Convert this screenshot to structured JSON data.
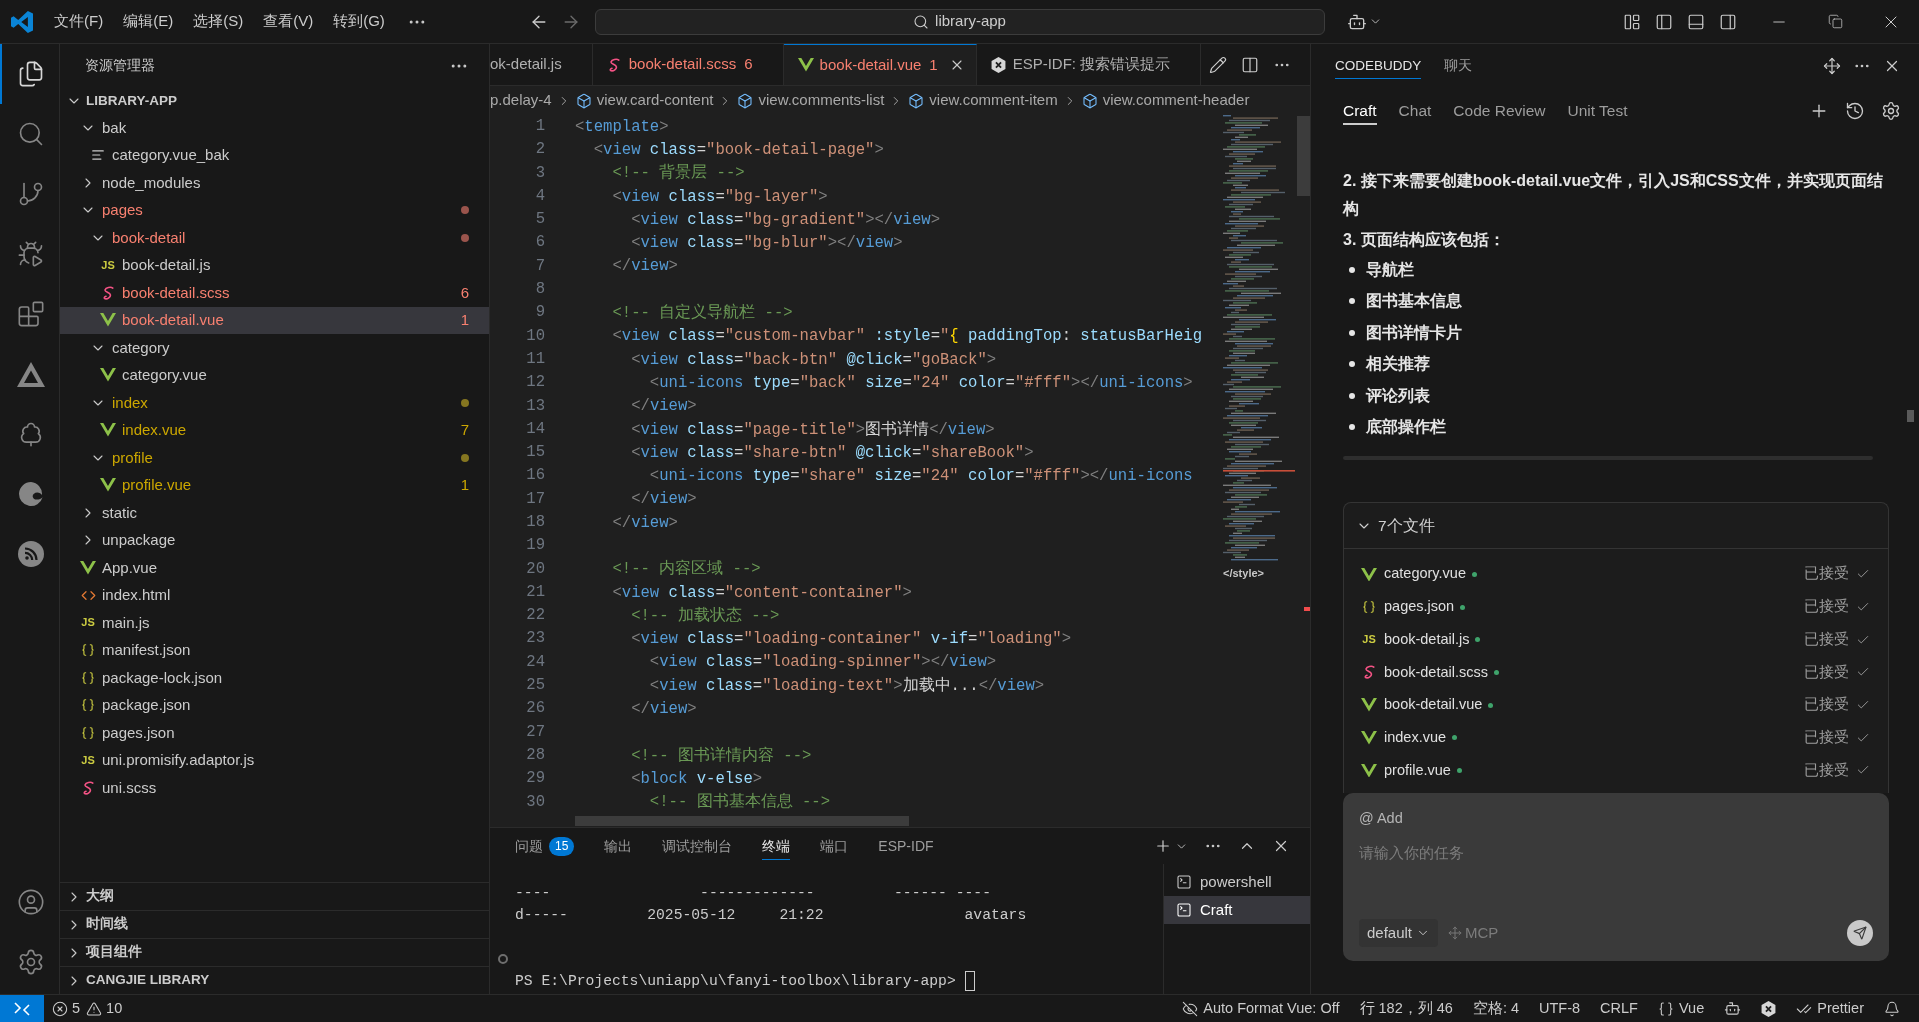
{
  "title_bar": {
    "menus": [
      "文件(F)",
      "编辑(E)",
      "选择(S)",
      "查看(V)",
      "转到(G)"
    ],
    "search": {
      "label": "library-app"
    }
  },
  "activity_bar": {
    "items": [
      {
        "kind": "explorer",
        "selected": true
      },
      {
        "kind": "search",
        "selected": false
      },
      {
        "kind": "source-control",
        "selected": false
      },
      {
        "kind": "run-debug",
        "selected": false
      },
      {
        "kind": "extensions",
        "selected": false
      },
      {
        "kind": "triangle",
        "selected": false
      },
      {
        "kind": "tree",
        "selected": false
      },
      {
        "kind": "swirl",
        "selected": false
      },
      {
        "kind": "signal",
        "selected": false
      }
    ],
    "bottom": [
      {
        "kind": "account"
      },
      {
        "kind": "settings"
      }
    ]
  },
  "explorer": {
    "title": "资源管理器",
    "root": {
      "label": "LIBRARY-APP",
      "expanded": true
    },
    "tree": [
      {
        "label": "bak",
        "kind": "folder",
        "expanded": true,
        "selected": false,
        "error": false,
        "warning": false,
        "children": [
          {
            "label": "category.vue_bak",
            "kind": "text",
            "selected": false,
            "error": false,
            "warning": false
          }
        ]
      },
      {
        "label": "node_modules",
        "kind": "folder",
        "expanded": false,
        "selected": false,
        "error": false,
        "warning": false
      },
      {
        "label": "pages",
        "kind": "folder",
        "expanded": true,
        "selected": false,
        "error": true,
        "warning": false,
        "children": [
          {
            "label": "book-detail",
            "kind": "folder",
            "expanded": true,
            "selected": false,
            "error": true,
            "warning": false,
            "children": [
              {
                "label": "book-detail.js",
                "kind": "js",
                "icon_text": "JS",
                "selected": false,
                "error": false,
                "warning": false
              },
              {
                "label": "book-detail.scss",
                "kind": "scss",
                "selected": false,
                "error": true,
                "warning": false,
                "badge": "6"
              },
              {
                "label": "book-detail.vue",
                "kind": "vue",
                "selected": true,
                "error": true,
                "warning": false,
                "badge": "1"
              }
            ]
          },
          {
            "label": "category",
            "kind": "folder",
            "expanded": true,
            "selected": false,
            "error": false,
            "warning": false,
            "children": [
              {
                "label": "category.vue",
                "kind": "vue",
                "selected": false,
                "error": false,
                "warning": false
              }
            ]
          },
          {
            "label": "index",
            "kind": "folder",
            "expanded": true,
            "selected": false,
            "error": false,
            "warning": true,
            "children": [
              {
                "label": "index.vue",
                "kind": "vue",
                "selected": false,
                "error": false,
                "warning": true,
                "badge": "7"
              }
            ]
          },
          {
            "label": "profile",
            "kind": "folder",
            "expanded": true,
            "selected": false,
            "error": false,
            "warning": true,
            "children": [
              {
                "label": "profile.vue",
                "kind": "vue",
                "selected": false,
                "error": false,
                "warning": true,
                "badge": "1"
              }
            ]
          }
        ]
      },
      {
        "label": "static",
        "kind": "folder",
        "expanded": false,
        "selected": false,
        "error": false,
        "warning": false
      },
      {
        "label": "unpackage",
        "kind": "folder",
        "expanded": false,
        "selected": false,
        "error": false,
        "warning": false
      },
      {
        "label": "App.vue",
        "kind": "vue",
        "selected": false,
        "error": false,
        "warning": false
      },
      {
        "label": "index.html",
        "kind": "html",
        "selected": false,
        "error": false,
        "warning": false
      },
      {
        "label": "main.js",
        "kind": "js",
        "icon_text": "JS",
        "selected": false,
        "error": false,
        "warning": false
      },
      {
        "label": "manifest.json",
        "kind": "json",
        "selected": false,
        "error": false,
        "warning": false
      },
      {
        "label": "package-lock.json",
        "kind": "json",
        "selected": false,
        "error": false,
        "warning": false
      },
      {
        "label": "package.json",
        "kind": "json",
        "selected": false,
        "error": false,
        "warning": false
      },
      {
        "label": "pages.json",
        "kind": "json",
        "selected": false,
        "error": false,
        "warning": false
      },
      {
        "label": "uni.promisify.adaptor.js",
        "kind": "js",
        "icon_text": "JS",
        "selected": false,
        "error": false,
        "warning": false
      },
      {
        "label": "uni.scss",
        "kind": "scss",
        "selected": false,
        "error": false,
        "warning": false
      }
    ],
    "sections": [
      {
        "label": "大纲",
        "expanded": false
      },
      {
        "label": "时间线",
        "expanded": false
      },
      {
        "label": "项目组件",
        "expanded": false
      },
      {
        "label": "CANGJIE LIBRARY",
        "expanded": false
      }
    ]
  },
  "editor": {
    "tabs": [
      {
        "label": "ok-detail.js",
        "error": false,
        "selected": false
      },
      {
        "label": "book-detail.scss",
        "kind": "scss",
        "error": true,
        "badge": "6",
        "selected": false
      },
      {
        "label": "book-detail.vue",
        "kind": "vue",
        "error": true,
        "badge": "1",
        "selected": true
      },
      {
        "label": "ESP-IDF: 搜索错误提示",
        "kind": "esp",
        "error": false,
        "selected": false
      }
    ],
    "breadcrumbs": [
      {
        "label": "p.delay-4"
      },
      {
        "label": "view.card-content",
        "kind": "element"
      },
      {
        "label": "view.comments-list",
        "kind": "element"
      },
      {
        "label": "view.comment-item",
        "kind": "element"
      },
      {
        "label": "view.comment-header",
        "kind": "element"
      }
    ],
    "lines": [
      {
        "number": "1",
        "tokens": [
          {
            "kind": "punct",
            "text": "<"
          },
          {
            "kind": "tag",
            "text": "template"
          },
          {
            "kind": "punct",
            "text": ">"
          }
        ]
      },
      {
        "number": "2",
        "tokens": [
          {
            "kind": "punct",
            "text": "  <"
          },
          {
            "kind": "tag",
            "text": "view"
          },
          {
            "kind": "attr",
            "text": " class"
          },
          {
            "kind": "text",
            "text": "="
          },
          {
            "kind": "string",
            "text": "\"book-detail-page\""
          },
          {
            "kind": "punct",
            "text": ">"
          }
        ]
      },
      {
        "number": "3",
        "tokens": [
          {
            "kind": "comment",
            "text": "    <!-- 背景层 -->"
          }
        ]
      },
      {
        "number": "4",
        "tokens": [
          {
            "kind": "punct",
            "text": "    <"
          },
          {
            "kind": "tag",
            "text": "view"
          },
          {
            "kind": "attr",
            "text": " class"
          },
          {
            "kind": "text",
            "text": "="
          },
          {
            "kind": "string",
            "text": "\"bg-layer\""
          },
          {
            "kind": "punct",
            "text": ">"
          }
        ]
      },
      {
        "number": "5",
        "tokens": [
          {
            "kind": "punct",
            "text": "      <"
          },
          {
            "kind": "tag",
            "text": "view"
          },
          {
            "kind": "attr",
            "text": " class"
          },
          {
            "kind": "text",
            "text": "="
          },
          {
            "kind": "string",
            "text": "\"bg-gradient\""
          },
          {
            "kind": "punct",
            "text": "></"
          },
          {
            "kind": "tag",
            "text": "view"
          },
          {
            "kind": "punct",
            "text": ">"
          }
        ]
      },
      {
        "number": "6",
        "tokens": [
          {
            "kind": "punct",
            "text": "      <"
          },
          {
            "kind": "tag",
            "text": "view"
          },
          {
            "kind": "attr",
            "text": " class"
          },
          {
            "kind": "text",
            "text": "="
          },
          {
            "kind": "string",
            "text": "\"bg-blur\""
          },
          {
            "kind": "punct",
            "text": "></"
          },
          {
            "kind": "tag",
            "text": "view"
          },
          {
            "kind": "punct",
            "text": ">"
          }
        ]
      },
      {
        "number": "7",
        "tokens": [
          {
            "kind": "punct",
            "text": "    </"
          },
          {
            "kind": "tag",
            "text": "view"
          },
          {
            "kind": "punct",
            "text": ">"
          }
        ]
      },
      {
        "number": "8"
      },
      {
        "number": "9",
        "tokens": [
          {
            "kind": "comment",
            "text": "    <!-- 自定义导航栏 -->"
          }
        ]
      },
      {
        "number": "10",
        "tokens": [
          {
            "kind": "punct",
            "text": "    <"
          },
          {
            "kind": "tag",
            "text": "view"
          },
          {
            "kind": "attr",
            "text": " class"
          },
          {
            "kind": "text",
            "text": "="
          },
          {
            "kind": "string",
            "text": "\"custom-navbar\""
          },
          {
            "kind": "attr",
            "text": " :style"
          },
          {
            "kind": "text",
            "text": "="
          },
          {
            "kind": "string",
            "text": "\""
          },
          {
            "kind": "brace",
            "text": "{"
          },
          {
            "kind": "attr",
            "text": " paddingTop"
          },
          {
            "kind": "text",
            "text": ":"
          },
          {
            "kind": "attr",
            "text": " statusBarHeig"
          }
        ]
      },
      {
        "number": "11",
        "tokens": [
          {
            "kind": "punct",
            "text": "      <"
          },
          {
            "kind": "tag",
            "text": "view"
          },
          {
            "kind": "attr",
            "text": " class"
          },
          {
            "kind": "text",
            "text": "="
          },
          {
            "kind": "string",
            "text": "\"back-btn\""
          },
          {
            "kind": "attr",
            "text": " @click"
          },
          {
            "kind": "text",
            "text": "="
          },
          {
            "kind": "string",
            "text": "\"goBack\""
          },
          {
            "kind": "punct",
            "text": ">"
          }
        ]
      },
      {
        "number": "12",
        "tokens": [
          {
            "kind": "punct",
            "text": "        <"
          },
          {
            "kind": "tag",
            "text": "uni-icons"
          },
          {
            "kind": "attr",
            "text": " type"
          },
          {
            "kind": "text",
            "text": "="
          },
          {
            "kind": "string",
            "text": "\"back\""
          },
          {
            "kind": "attr",
            "text": " size"
          },
          {
            "kind": "text",
            "text": "="
          },
          {
            "kind": "string",
            "text": "\"24\""
          },
          {
            "kind": "attr",
            "text": " color"
          },
          {
            "kind": "text",
            "text": "="
          },
          {
            "kind": "string",
            "text": "\"#fff\""
          },
          {
            "kind": "punct",
            "text": "></"
          },
          {
            "kind": "tag",
            "text": "uni-icons"
          },
          {
            "kind": "punct",
            "text": ">"
          }
        ]
      },
      {
        "number": "13",
        "tokens": [
          {
            "kind": "punct",
            "text": "      </"
          },
          {
            "kind": "tag",
            "text": "view"
          },
          {
            "kind": "punct",
            "text": ">"
          }
        ]
      },
      {
        "number": "14",
        "tokens": [
          {
            "kind": "punct",
            "text": "      <"
          },
          {
            "kind": "tag",
            "text": "view"
          },
          {
            "kind": "attr",
            "text": " class"
          },
          {
            "kind": "text",
            "text": "="
          },
          {
            "kind": "string",
            "text": "\"page-title\""
          },
          {
            "kind": "punct",
            "text": ">"
          },
          {
            "kind": "text",
            "text": "图书详情"
          },
          {
            "kind": "punct",
            "text": "</"
          },
          {
            "kind": "tag",
            "text": "view"
          },
          {
            "kind": "punct",
            "text": ">"
          }
        ]
      },
      {
        "number": "15",
        "tokens": [
          {
            "kind": "punct",
            "text": "      <"
          },
          {
            "kind": "tag",
            "text": "view"
          },
          {
            "kind": "attr",
            "text": " class"
          },
          {
            "kind": "text",
            "text": "="
          },
          {
            "kind": "string",
            "text": "\"share-btn\""
          },
          {
            "kind": "attr",
            "text": " @click"
          },
          {
            "kind": "text",
            "text": "="
          },
          {
            "kind": "string",
            "text": "\"shareBook\""
          },
          {
            "kind": "punct",
            "text": ">"
          }
        ]
      },
      {
        "number": "16",
        "tokens": [
          {
            "kind": "punct",
            "text": "        <"
          },
          {
            "kind": "tag",
            "text": "uni-icons"
          },
          {
            "kind": "attr",
            "text": " type"
          },
          {
            "kind": "text",
            "text": "="
          },
          {
            "kind": "string",
            "text": "\"share\""
          },
          {
            "kind": "attr",
            "text": " size"
          },
          {
            "kind": "text",
            "text": "="
          },
          {
            "kind": "string",
            "text": "\"24\""
          },
          {
            "kind": "attr",
            "text": " color"
          },
          {
            "kind": "text",
            "text": "="
          },
          {
            "kind": "string",
            "text": "\"#fff\""
          },
          {
            "kind": "punct",
            "text": "></"
          },
          {
            "kind": "tag",
            "text": "uni-icons"
          }
        ]
      },
      {
        "number": "17",
        "tokens": [
          {
            "kind": "punct",
            "text": "      </"
          },
          {
            "kind": "tag",
            "text": "view"
          },
          {
            "kind": "punct",
            "text": ">"
          }
        ]
      },
      {
        "number": "18",
        "tokens": [
          {
            "kind": "punct",
            "text": "    </"
          },
          {
            "kind": "tag",
            "text": "view"
          },
          {
            "kind": "punct",
            "text": ">"
          }
        ]
      },
      {
        "number": "19"
      },
      {
        "number": "20",
        "tokens": [
          {
            "kind": "comment",
            "text": "    <!-- 内容区域 -->"
          }
        ]
      },
      {
        "number": "21",
        "tokens": [
          {
            "kind": "punct",
            "text": "    <"
          },
          {
            "kind": "tag",
            "text": "view"
          },
          {
            "kind": "attr",
            "text": " class"
          },
          {
            "kind": "text",
            "text": "="
          },
          {
            "kind": "string",
            "text": "\"content-container\""
          },
          {
            "kind": "punct",
            "text": ">"
          }
        ]
      },
      {
        "number": "22",
        "tokens": [
          {
            "kind": "comment",
            "text": "      <!-- 加载状态 -->"
          }
        ]
      },
      {
        "number": "23",
        "tokens": [
          {
            "kind": "punct",
            "text": "      <"
          },
          {
            "kind": "tag",
            "text": "view"
          },
          {
            "kind": "attr",
            "text": " class"
          },
          {
            "kind": "text",
            "text": "="
          },
          {
            "kind": "string",
            "text": "\"loading-container\""
          },
          {
            "kind": "attr",
            "text": " v-if"
          },
          {
            "kind": "text",
            "text": "="
          },
          {
            "kind": "string",
            "text": "\"loading\""
          },
          {
            "kind": "punct",
            "text": ">"
          }
        ]
      },
      {
        "number": "24",
        "tokens": [
          {
            "kind": "punct",
            "text": "        <"
          },
          {
            "kind": "tag",
            "text": "view"
          },
          {
            "kind": "attr",
            "text": " class"
          },
          {
            "kind": "text",
            "text": "="
          },
          {
            "kind": "string",
            "text": "\"loading-spinner\""
          },
          {
            "kind": "punct",
            "text": "></"
          },
          {
            "kind": "tag",
            "text": "view"
          },
          {
            "kind": "punct",
            "text": ">"
          }
        ]
      },
      {
        "number": "25",
        "tokens": [
          {
            "kind": "punct",
            "text": "        <"
          },
          {
            "kind": "tag",
            "text": "view"
          },
          {
            "kind": "attr",
            "text": " class"
          },
          {
            "kind": "text",
            "text": "="
          },
          {
            "kind": "string",
            "text": "\"loading-text\""
          },
          {
            "kind": "punct",
            "text": ">"
          },
          {
            "kind": "text",
            "text": "加载中..."
          },
          {
            "kind": "punct",
            "text": "</"
          },
          {
            "kind": "tag",
            "text": "view"
          },
          {
            "kind": "punct",
            "text": ">"
          }
        ]
      },
      {
        "number": "26",
        "tokens": [
          {
            "kind": "punct",
            "text": "      </"
          },
          {
            "kind": "tag",
            "text": "view"
          },
          {
            "kind": "punct",
            "text": ">"
          }
        ]
      },
      {
        "number": "27"
      },
      {
        "number": "28",
        "tokens": [
          {
            "kind": "comment",
            "text": "      <!-- 图书详情内容 -->"
          }
        ]
      },
      {
        "number": "29",
        "tokens": [
          {
            "kind": "punct",
            "text": "      <"
          },
          {
            "kind": "tag",
            "text": "block"
          },
          {
            "kind": "attr",
            "text": " v-else"
          },
          {
            "kind": "punct",
            "text": ">"
          }
        ]
      },
      {
        "number": "30",
        "tokens": [
          {
            "kind": "comment",
            "text": "        <!-- 图书基本信息 -->"
          }
        ]
      }
    ],
    "minimap": {
      "label": "</style>"
    }
  },
  "panel": {
    "tabs": [
      {
        "label": "问题",
        "badge": "15",
        "selected": false
      },
      {
        "label": "输出",
        "selected": false
      },
      {
        "label": "调试控制台",
        "selected": false
      },
      {
        "label": "终端",
        "selected": true
      },
      {
        "label": "端口",
        "selected": false
      },
      {
        "label": "ESP-IDF",
        "selected": false
      }
    ],
    "terminal": {
      "lines": [
        "----                 -------------         ------ ----",
        "d-----         2025-05-12     21:22                avatars"
      ],
      "prompt": "PS E:\\Projects\\uniapp\\u\\fanyi-toolbox\\library-app>"
    },
    "terminals": [
      {
        "label": "powershell",
        "selected": false
      },
      {
        "label": "Craft",
        "selected": true
      }
    ]
  },
  "assistant": {
    "header_tabs": [
      {
        "label": "CODEBUDDY",
        "selected": true
      },
      {
        "label": "聊天",
        "selected": false
      }
    ],
    "mode_tabs": [
      {
        "label": "Craft",
        "selected": true
      },
      {
        "label": "Chat",
        "selected": false
      },
      {
        "label": "Code Review",
        "selected": false
      },
      {
        "label": "Unit Test",
        "selected": false
      }
    ],
    "message": {
      "paragraphs": [
        "2. 接下来需要创建book-detail.vue文件，引入JS和CSS文件，并实现页面结构",
        "3. 页面结构应该包括："
      ],
      "bullets": [
        "导航栏",
        "图书基本信息",
        "图书详情卡片",
        "相关推荐",
        "评论列表",
        "底部操作栏"
      ]
    },
    "files": {
      "title": "7个文件",
      "expanded": true,
      "items": [
        {
          "name": "category.vue",
          "kind": "vue",
          "status": "已接受",
          "accepted": true
        },
        {
          "name": "pages.json",
          "kind": "json",
          "status": "已接受",
          "accepted": true
        },
        {
          "name": "book-detail.js",
          "kind": "js",
          "icon_text": "JS",
          "status": "已接受",
          "accepted": true
        },
        {
          "name": "book-detail.scss",
          "kind": "scss",
          "status": "已接受",
          "accepted": true
        },
        {
          "name": "book-detail.vue",
          "kind": "vue",
          "status": "已接受",
          "accepted": true
        },
        {
          "name": "index.vue",
          "kind": "vue",
          "status": "已接受",
          "accepted": true
        },
        {
          "name": "profile.vue",
          "kind": "vue",
          "status": "已接受",
          "accepted": true
        }
      ]
    },
    "composer": {
      "mention": "@ Add",
      "placeholder": "请输入你的任务",
      "mode": "default",
      "tool": "MCP"
    }
  },
  "status_bar": {
    "problems": {
      "errors": "5",
      "warnings": "10"
    },
    "items": [
      {
        "kind": "format",
        "label": "Auto Format Vue: Off"
      },
      {
        "kind": "text",
        "label": "行 182，列 46"
      },
      {
        "kind": "text",
        "label": "空格: 4"
      },
      {
        "kind": "text",
        "label": "UTF-8"
      },
      {
        "kind": "text",
        "label": "CRLF"
      },
      {
        "kind": "language",
        "label": "Vue"
      },
      {
        "kind": "copilot"
      },
      {
        "kind": "esp"
      },
      {
        "kind": "prettier",
        "label": "Prettier"
      },
      {
        "kind": "notifications"
      }
    ]
  }
}
